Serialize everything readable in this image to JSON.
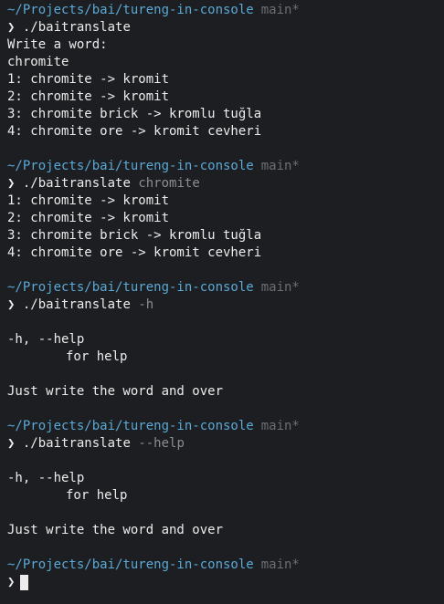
{
  "terminal": {
    "path": "~/Projects/bai/tureng-in-console",
    "branch": "main*",
    "prompt_symbol": "❯",
    "blocks": [
      {
        "command": "./baitranslate",
        "argument": "",
        "output": [
          "Write a word:",
          "chromite",
          "1: chromite -> kromit",
          "2: chromite -> kromit",
          "3: chromite brick -> kromlu tuğla",
          "4: chromite ore -> kromit cevheri"
        ]
      },
      {
        "command": "./baitranslate",
        "argument": "chromite",
        "output": [
          "1: chromite -> kromit",
          "2: chromite -> kromit",
          "3: chromite brick -> kromlu tuğla",
          "4: chromite ore -> kromit cevheri"
        ]
      },
      {
        "command": "./baitranslate",
        "argument": "-h",
        "output": [
          "",
          "-h, --help",
          "for help",
          "",
          "Just write the word and over"
        ]
      },
      {
        "command": "./baitranslate",
        "argument": "--help",
        "output": [
          "",
          "-h, --help",
          "for help",
          "",
          "Just write the word and over"
        ]
      }
    ]
  }
}
